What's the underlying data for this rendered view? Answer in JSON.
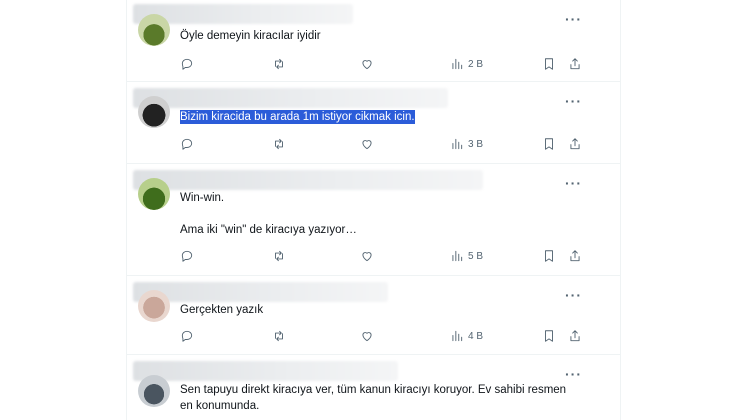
{
  "tweets": [
    {
      "text": "Öyle demeyin kiracılar iyidir",
      "views": "2 B",
      "selected": false
    },
    {
      "text": "Bizim kiracida bu arada 1m istiyor cikmak icin.",
      "views": "3 B",
      "selected": true
    },
    {
      "text": "Win-win.\n\nAma iki \"win\" de kiracıya yazıyor…",
      "views": "5 B",
      "selected": false
    },
    {
      "text": "Gerçekten yazık",
      "views": "4 B",
      "selected": false
    },
    {
      "text": "Sen tapuyu direkt kiracıya ver, tüm kanun kiracıyı koruyor. Ev sahibi resmen\nen konumunda.",
      "views": "",
      "selected": false
    }
  ],
  "icons": {
    "more": "more-icon",
    "reply": "reply-icon",
    "retweet": "retweet-icon",
    "like": "heart-icon",
    "views": "views-icon",
    "bookmark": "bookmark-icon",
    "share": "share-icon"
  },
  "colors": {
    "icon": "#536471",
    "selection": "#2b5cd9",
    "border": "#eff3f4"
  }
}
